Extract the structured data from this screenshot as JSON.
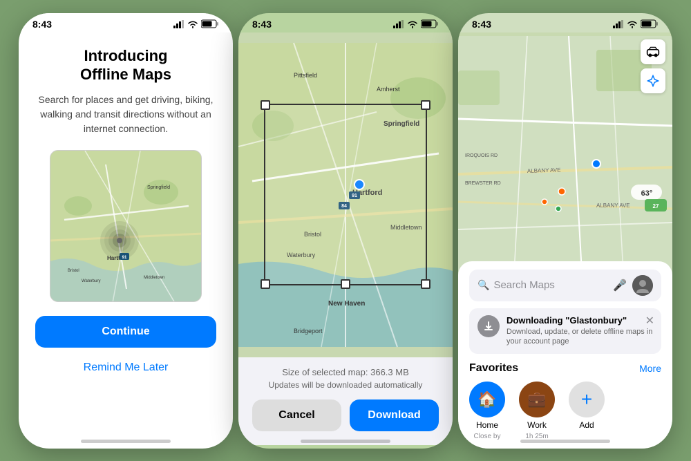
{
  "screen1": {
    "status_time": "8:43",
    "title": "Introducing\nOffline Maps",
    "description": "Search for places and get driving, biking, walking and transit directions without an internet connection.",
    "continue_label": "Continue",
    "remind_label": "Remind Me Later"
  },
  "screen2": {
    "status_time": "8:43",
    "size_text": "Size of selected map: 366.3 MB",
    "auto_text": "Updates will be downloaded automatically",
    "cancel_label": "Cancel",
    "download_label": "Download"
  },
  "screen3": {
    "status_time": "8:43",
    "search_placeholder": "Search Maps",
    "banner_title": "Downloading \"Glastonbury\"",
    "banner_desc": "Download, update, or delete offline maps in your account page",
    "favorites_title": "Favorites",
    "more_label": "More",
    "favorites": [
      {
        "id": "home",
        "label": "Home",
        "sublabel": "Close by",
        "icon": "🏠",
        "color": "#007AFF"
      },
      {
        "id": "work",
        "label": "Work",
        "sublabel": "1h 25m",
        "icon": "💼",
        "color": "#8B4513"
      },
      {
        "id": "add",
        "label": "Add",
        "sublabel": "",
        "icon": "+",
        "color": "#e0e0e0"
      }
    ]
  }
}
